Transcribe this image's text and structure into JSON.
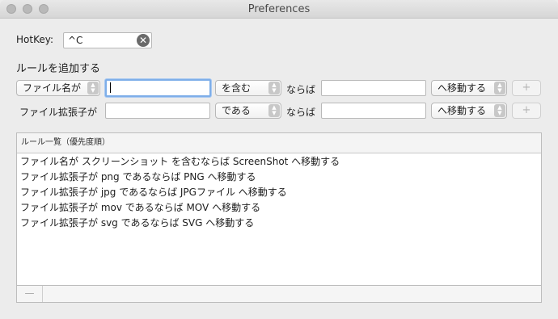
{
  "window": {
    "title": "Preferences"
  },
  "hotkey": {
    "label": "HotKey:",
    "value": "^C"
  },
  "section_title": "ルールを追加する",
  "rule_rows": [
    {
      "source_label": "ファイル名が",
      "text_value": "",
      "operator": "を含む",
      "connector": "ならば",
      "target_value": "",
      "action": "へ移動する",
      "add_label": "+"
    },
    {
      "source_label": "ファイル拡張子が",
      "text_value": "",
      "operator": "である",
      "connector": "ならば",
      "target_value": "",
      "action": "へ移動する",
      "add_label": "+"
    }
  ],
  "rule_list": {
    "header": "ルール一覧（優先度順）",
    "items": [
      "ファイル名が スクリーンショット を含むならば ScreenShot へ移動する",
      "ファイル拡張子が png であるならば PNG へ移動する",
      "ファイル拡張子が jpg であるならば JPGファイル へ移動する",
      "ファイル拡張子が mov であるならば MOV へ移動する",
      "ファイル拡張子が svg であるならば SVG へ移動する"
    ],
    "remove_label": "—"
  },
  "colors": {
    "focus_ring": "#7eaee9",
    "window_bg": "#ececec"
  },
  "icons": {
    "clear": "clear-circle-icon",
    "popup": "up-down-chevron-icon"
  }
}
